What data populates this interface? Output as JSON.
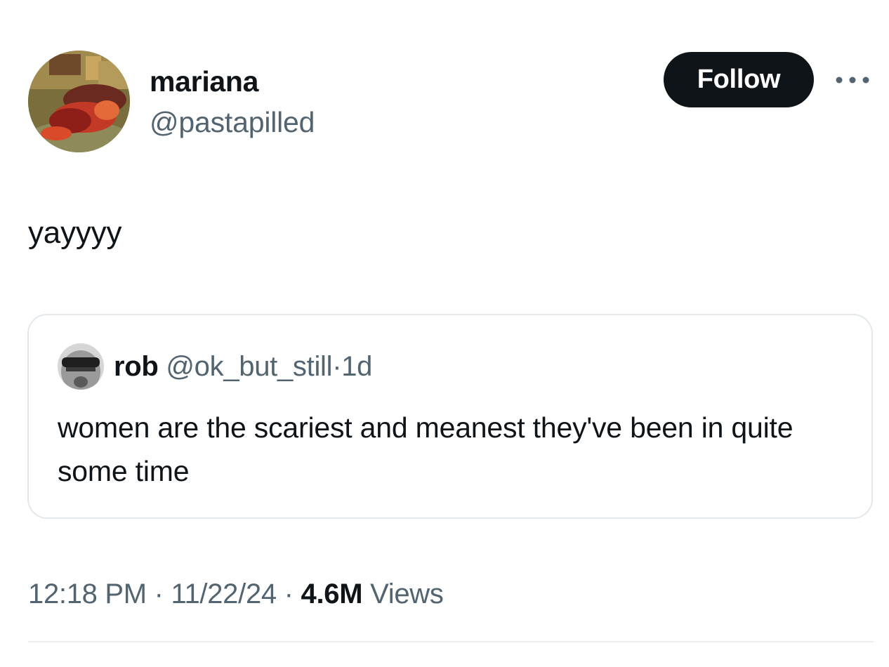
{
  "author": {
    "display_name": "mariana",
    "handle": "@pastapilled"
  },
  "actions": {
    "follow_label": "Follow",
    "more_icon": "more-horizontal-icon"
  },
  "tweet": {
    "text": "yayyyy"
  },
  "quoted_tweet": {
    "display_name": "rob",
    "handle": "@ok_but_still",
    "separator": "·",
    "time": "1d",
    "text": "women are the scariest and meanest they've been in quite some time"
  },
  "meta": {
    "time": "12:18 PM",
    "separator": "·",
    "date": "11/22/24",
    "views_count": "4.6M",
    "views_label": "Views"
  },
  "colors": {
    "text_primary": "#0f1419",
    "text_secondary": "#536471",
    "button_bg": "#0f1419",
    "border": "#e3e8ec"
  }
}
